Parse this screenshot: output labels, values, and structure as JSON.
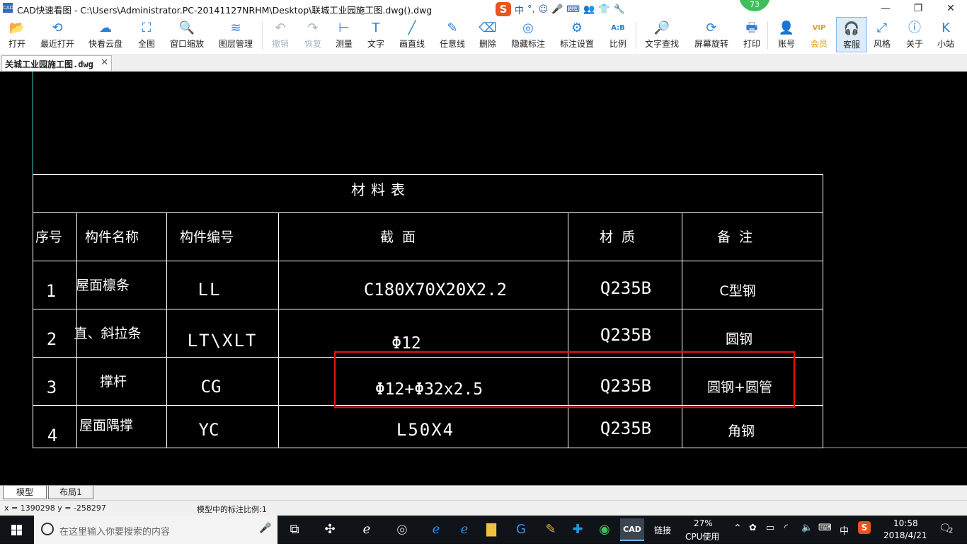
{
  "window": {
    "app_icon_text": "CAD",
    "title": "CAD快速看图 - C:\\Users\\Administrator.PC-20141127NRHM\\Desktop\\联城工业园施工图.dwg().dwg",
    "controls": {
      "minimize": "—",
      "restore": "❐",
      "close": "✕"
    }
  },
  "ime": {
    "logo": "S",
    "items": [
      "中",
      "°,",
      "☺",
      "🎤",
      "⌨",
      "👥",
      "👕",
      "🔧"
    ]
  },
  "badge": {
    "value": "73"
  },
  "toolbar": {
    "items": [
      {
        "id": "open",
        "label": "打开",
        "icon": "folder-open-icon",
        "glyph": "📂"
      },
      {
        "id": "recent",
        "label": "最近打开",
        "icon": "history-icon",
        "glyph": "⟲"
      },
      {
        "id": "cloud",
        "label": "快看云盘",
        "icon": "cloud-icon",
        "glyph": "☁"
      },
      {
        "id": "fullview",
        "label": "全图",
        "icon": "fullview-icon",
        "glyph": "⛶"
      },
      {
        "id": "zoomwin",
        "label": "窗口缩放",
        "icon": "zoom-window-icon",
        "glyph": "🔍"
      },
      {
        "id": "layers",
        "label": "图层管理",
        "icon": "layers-icon",
        "glyph": "≋"
      },
      {
        "id": "undo",
        "label": "撤销",
        "icon": "undo-icon",
        "glyph": "↶",
        "disabled": true
      },
      {
        "id": "redo",
        "label": "恢复",
        "icon": "redo-icon",
        "glyph": "↷",
        "disabled": true
      },
      {
        "id": "measure",
        "label": "测量",
        "icon": "ruler-icon",
        "glyph": "⊢"
      },
      {
        "id": "text",
        "label": "文字",
        "icon": "text-icon",
        "glyph": "T"
      },
      {
        "id": "line",
        "label": "画直线",
        "icon": "line-icon",
        "glyph": "╱"
      },
      {
        "id": "freeline",
        "label": "任意线",
        "icon": "pen-icon",
        "glyph": "✎"
      },
      {
        "id": "erase",
        "label": "删除",
        "icon": "eraser-icon",
        "glyph": "⌫"
      },
      {
        "id": "hide",
        "label": "隐藏标注",
        "icon": "eye-hide-icon",
        "glyph": "◎"
      },
      {
        "id": "annot",
        "label": "标注设置",
        "icon": "annotation-settings-icon",
        "glyph": "⚙"
      },
      {
        "id": "ratio",
        "label": "比例",
        "icon": "scale-icon",
        "glyph": "A:B"
      },
      {
        "id": "findtext",
        "label": "文字查找",
        "icon": "find-text-icon",
        "glyph": "🔎"
      },
      {
        "id": "rotate",
        "label": "屏幕旋转",
        "icon": "rotate-screen-icon",
        "glyph": "⟳"
      },
      {
        "id": "print",
        "label": "打印",
        "icon": "printer-icon",
        "glyph": "🖶"
      },
      {
        "id": "account",
        "label": "账号",
        "icon": "user-icon",
        "glyph": "👤"
      },
      {
        "id": "vip",
        "label": "会员",
        "icon": "vip-icon",
        "glyph": "VIP",
        "vip": true
      },
      {
        "id": "service",
        "label": "客服",
        "icon": "headset-icon",
        "glyph": "🎧",
        "active": true
      },
      {
        "id": "style",
        "label": "风格",
        "icon": "style-icon",
        "glyph": "⤢"
      },
      {
        "id": "about",
        "label": "关于",
        "icon": "info-icon",
        "glyph": "ⓘ"
      },
      {
        "id": "station",
        "label": "小站",
        "icon": "station-icon",
        "glyph": "K"
      }
    ]
  },
  "doc_tab": {
    "label": "关城工业园施工图.dwg",
    "close": "✕"
  },
  "drawing": {
    "table_title": "材料表",
    "headers": [
      "序号",
      "构件名称",
      "构件编号",
      "截  面",
      "材  质",
      "备  注"
    ],
    "rows": [
      [
        "1",
        "屋面檩条",
        "LL",
        "C180X70X20X2.2",
        "Q235B",
        "C型钢"
      ],
      [
        "2",
        "直、斜拉条",
        "LT\\XLT",
        "Φ12",
        "Q235B",
        "圆钢"
      ],
      [
        "3",
        "撑杆",
        "CG",
        "Φ12+Φ32x2.5",
        "Q235B",
        "圆钢+圆管"
      ],
      [
        "4",
        "屋面隅撑",
        "YC",
        "L50X4",
        "Q235B",
        "角钢"
      ]
    ],
    "highlight_color": "#e01010"
  },
  "layout_tabs": [
    "模型",
    "布局1"
  ],
  "status": {
    "coords": "x = 1390298  y = -258297",
    "scale_text": "模型中的标注比例:1"
  },
  "taskbar": {
    "search_placeholder": "在这里输入你要搜索的内容",
    "apps": [
      "task-view-icon",
      "fan-app-icon",
      "ie-icon",
      "browser-swirl-icon",
      "edge-icon",
      "ie-blue-icon",
      "file-explorer-icon",
      "sogou-browser-icon",
      "notepad-icon",
      "add-app-icon",
      "360-icon",
      "cad-app-icon"
    ],
    "link_label": "链接",
    "cpu_percent": "27%",
    "cpu_label": "CPU使用",
    "lang": "中",
    "time": "10:58",
    "date": "2018/4/21",
    "notifications": "2"
  }
}
